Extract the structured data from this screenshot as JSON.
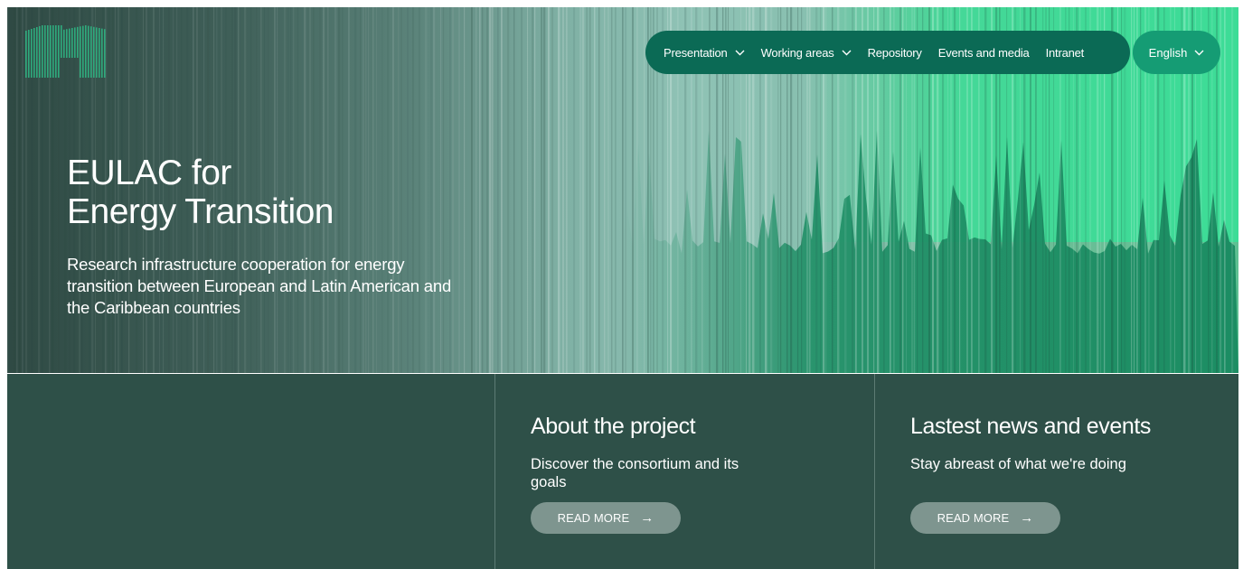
{
  "nav": {
    "items": [
      {
        "label": "Presentation",
        "has_dropdown": true
      },
      {
        "label": "Working areas",
        "has_dropdown": true
      },
      {
        "label": "Repository",
        "has_dropdown": false
      },
      {
        "label": "Events and media",
        "has_dropdown": false
      },
      {
        "label": "Intranet",
        "has_dropdown": false
      }
    ],
    "language": "English"
  },
  "hero": {
    "title_line1": "EULAC for",
    "title_line2": "Energy Transition",
    "subtitle": "Research infrastructure cooperation for energy transition between European and Latin American and the Caribbean countries"
  },
  "cards": [
    {
      "title": "About the project",
      "text": "Discover the consortium and its goals",
      "button": "READ MORE",
      "arrow": "→"
    },
    {
      "title": "Lastest news and events",
      "text": "Stay abreast of what we're doing",
      "button": "READ MORE",
      "arrow": "→"
    }
  ],
  "colors": {
    "nav_bg": "#0b6a55",
    "lang_bg": "#159c74",
    "bottom_bg": "#2e5048",
    "button_bg": "#7e958f",
    "accent_green": "#3ddc97"
  },
  "icons": {
    "logo": "eulac-logo",
    "dropdown": "chevron-down-icon",
    "arrow": "arrow-right-icon"
  }
}
